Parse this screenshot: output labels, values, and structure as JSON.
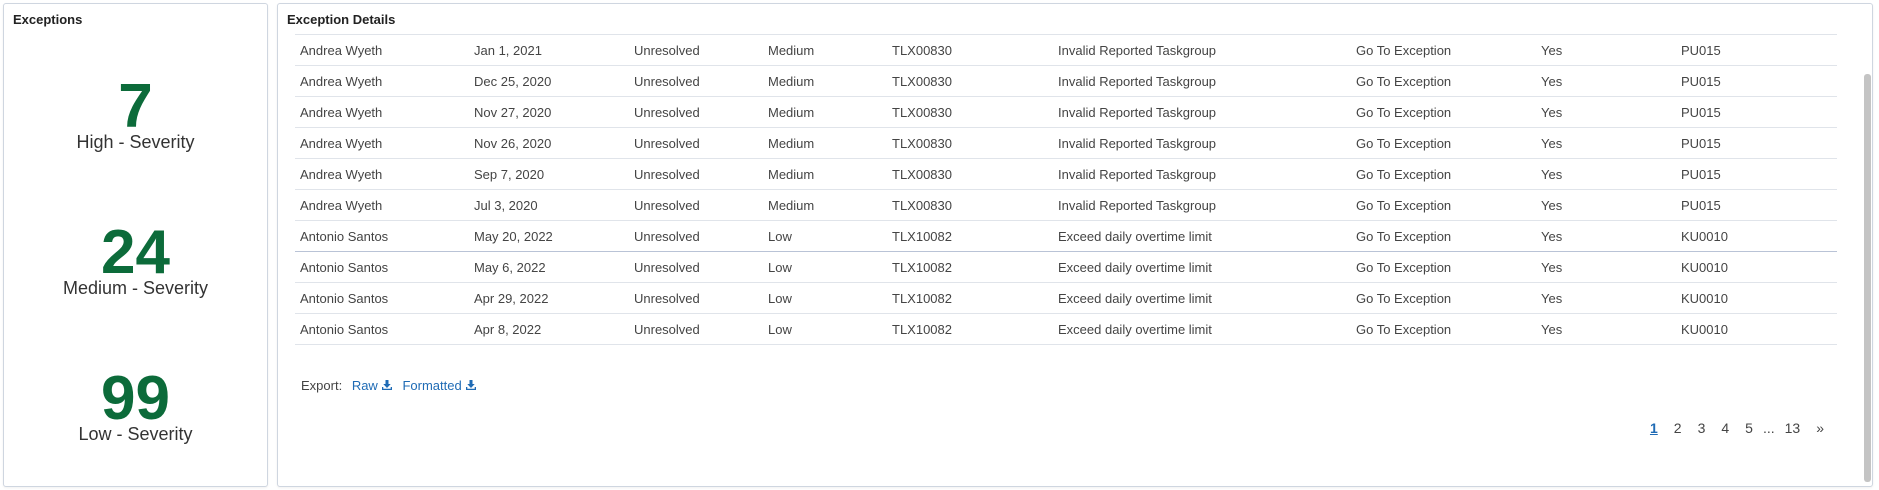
{
  "exceptions_panel": {
    "title": "Exceptions",
    "metrics": [
      {
        "count": "7",
        "label": "High - Severity"
      },
      {
        "count": "24",
        "label": "Medium - Severity"
      },
      {
        "count": "99",
        "label": "Low - Severity"
      }
    ]
  },
  "details_panel": {
    "title": "Exception Details",
    "rows": [
      [
        "Andrea Wyeth",
        "Jan 1, 2021",
        "Unresolved",
        "Medium",
        "TLX00830",
        "Invalid Reported Taskgroup",
        "Go To Exception",
        "Yes",
        "PU015"
      ],
      [
        "Andrea Wyeth",
        "Dec 25, 2020",
        "Unresolved",
        "Medium",
        "TLX00830",
        "Invalid Reported Taskgroup",
        "Go To Exception",
        "Yes",
        "PU015"
      ],
      [
        "Andrea Wyeth",
        "Nov 27, 2020",
        "Unresolved",
        "Medium",
        "TLX00830",
        "Invalid Reported Taskgroup",
        "Go To Exception",
        "Yes",
        "PU015"
      ],
      [
        "Andrea Wyeth",
        "Nov 26, 2020",
        "Unresolved",
        "Medium",
        "TLX00830",
        "Invalid Reported Taskgroup",
        "Go To Exception",
        "Yes",
        "PU015"
      ],
      [
        "Andrea Wyeth",
        "Sep 7, 2020",
        "Unresolved",
        "Medium",
        "TLX00830",
        "Invalid Reported Taskgroup",
        "Go To Exception",
        "Yes",
        "PU015"
      ],
      [
        "Andrea Wyeth",
        "Jul 3, 2020",
        "Unresolved",
        "Medium",
        "TLX00830",
        "Invalid Reported Taskgroup",
        "Go To Exception",
        "Yes",
        "PU015"
      ],
      [
        "Antonio Santos",
        "May 20, 2022",
        "Unresolved",
        "Low",
        "TLX10082",
        "Exceed daily overtime limit",
        "Go To Exception",
        "Yes",
        "KU0010"
      ],
      [
        "Antonio Santos",
        "May 6, 2022",
        "Unresolved",
        "Low",
        "TLX10082",
        "Exceed daily overtime limit",
        "Go To Exception",
        "Yes",
        "KU0010"
      ],
      [
        "Antonio Santos",
        "Apr 29, 2022",
        "Unresolved",
        "Low",
        "TLX10082",
        "Exceed daily overtime limit",
        "Go To Exception",
        "Yes",
        "KU0010"
      ],
      [
        "Antonio Santos",
        "Apr 8, 2022",
        "Unresolved",
        "Low",
        "TLX10082",
        "Exceed daily overtime limit",
        "Go To Exception",
        "Yes",
        "KU0010"
      ]
    ],
    "export": {
      "label": "Export:",
      "raw": "Raw",
      "formatted": "Formatted"
    },
    "pagination": {
      "pages": [
        "1",
        "2",
        "3",
        "4",
        "5"
      ],
      "current": "1",
      "ellipsis": "...",
      "last": "13",
      "next": "»"
    }
  },
  "colors": {
    "metric_green": "#0c6b3a",
    "link_blue": "#1f6bb5"
  },
  "icons": {
    "download": "download-icon"
  }
}
